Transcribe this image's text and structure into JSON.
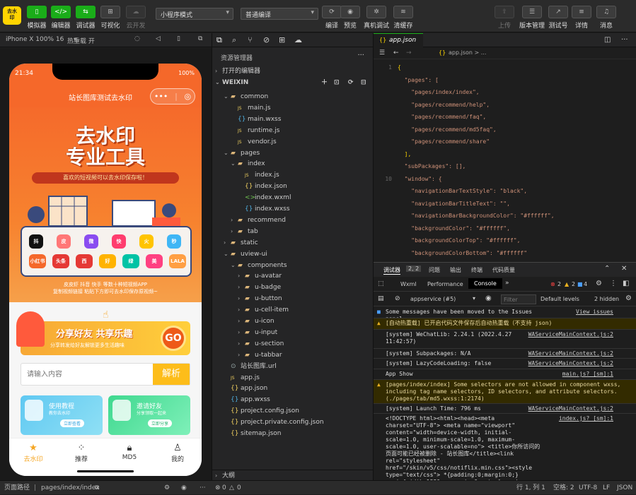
{
  "toolbar": {
    "buttons": [
      {
        "label": "模拟器",
        "icon": "phone-icon"
      },
      {
        "label": "编辑器",
        "icon": "code-icon"
      },
      {
        "label": "调试器",
        "icon": "debug-icon"
      },
      {
        "label": "可视化",
        "icon": "grid-icon"
      },
      {
        "label": "云开发",
        "icon": "cloud-icon"
      }
    ],
    "mode_select": "小程序模式",
    "compile_select": "普通编译",
    "mid_buttons": [
      "编译",
      "预览",
      "真机调试",
      "清缓存"
    ],
    "right_buttons": [
      "上传",
      "版本管理",
      "测试号",
      "详情",
      "消息"
    ]
  },
  "simulator": {
    "device": "iPhone X 100% 16",
    "hot_reload": "热重载 开",
    "status_time": "21:34",
    "battery": "100%",
    "nav_title": "站长图库测试去水印",
    "banner_title_1": "去水印",
    "banner_title_2": "专业工具",
    "ribbon": "喜欢的短视频可以去水印保存啦！",
    "banner_sub_1": "皮皮虾 抖音 快手 等数十种短视频APP",
    "banner_sub_2": "复制视频链接 粘贴下方即可去水印保存原视频~",
    "apps": [
      "抖",
      "皮",
      "微",
      "快",
      "火",
      "秒",
      "小红书",
      "头条",
      "西",
      "好",
      "绿",
      "美",
      "LALA"
    ],
    "share_title": "分享好友 共享乐趣",
    "share_sub": "分享转发给好友解锁更多生活趣味",
    "go": "GO",
    "search_placeholder": "请输入内容",
    "parse_button": "解析",
    "card1_title": "使用教程",
    "card1_sub": "教你去水印",
    "card1_btn": "立即查看",
    "card2_title": "邀请好友",
    "card2_sub": "分享领取一起来",
    "card2_btn": "立即分享",
    "tabs": [
      {
        "label": "去水印",
        "icon": "star-icon"
      },
      {
        "label": "推荐",
        "icon": "grid-icon"
      },
      {
        "label": "MD5",
        "icon": "lock-icon"
      },
      {
        "label": "我的",
        "icon": "user-icon"
      }
    ]
  },
  "explorer": {
    "title": "资源管理器",
    "open_editors": "打开的编辑器",
    "root": "WEIXIN",
    "outline": "大纲",
    "tree": [
      {
        "name": "common",
        "depth": 1,
        "type": "folder",
        "open": true
      },
      {
        "name": "main.js",
        "depth": 2,
        "type": "js"
      },
      {
        "name": "main.wxss",
        "depth": 2,
        "type": "wxss"
      },
      {
        "name": "runtime.js",
        "depth": 2,
        "type": "js"
      },
      {
        "name": "vendor.js",
        "depth": 2,
        "type": "js"
      },
      {
        "name": "pages",
        "depth": 1,
        "type": "folder",
        "open": true
      },
      {
        "name": "index",
        "depth": 2,
        "type": "folder",
        "open": true
      },
      {
        "name": "index.js",
        "depth": 3,
        "type": "js"
      },
      {
        "name": "index.json",
        "depth": 3,
        "type": "json"
      },
      {
        "name": "index.wxml",
        "depth": 3,
        "type": "wxml"
      },
      {
        "name": "index.wxss",
        "depth": 3,
        "type": "wxss"
      },
      {
        "name": "recommend",
        "depth": 2,
        "type": "folder",
        "open": false
      },
      {
        "name": "tab",
        "depth": 2,
        "type": "folder",
        "open": false
      },
      {
        "name": "static",
        "depth": 1,
        "type": "folder",
        "open": false
      },
      {
        "name": "uview-ui",
        "depth": 1,
        "type": "folder",
        "open": true
      },
      {
        "name": "components",
        "depth": 2,
        "type": "folder",
        "open": true
      },
      {
        "name": "u-avatar",
        "depth": 3,
        "type": "folder",
        "open": false
      },
      {
        "name": "u-badge",
        "depth": 3,
        "type": "folder",
        "open": false
      },
      {
        "name": "u-button",
        "depth": 3,
        "type": "folder",
        "open": false
      },
      {
        "name": "u-cell-item",
        "depth": 3,
        "type": "folder",
        "open": false
      },
      {
        "name": "u-icon",
        "depth": 3,
        "type": "folder",
        "open": false
      },
      {
        "name": "u-input",
        "depth": 3,
        "type": "folder",
        "open": false
      },
      {
        "name": "u-section",
        "depth": 3,
        "type": "folder",
        "open": false
      },
      {
        "name": "u-tabbar",
        "depth": 3,
        "type": "folder",
        "open": false
      },
      {
        "name": "站长图库.url",
        "depth": 1,
        "type": "url"
      },
      {
        "name": "app.js",
        "depth": 1,
        "type": "js"
      },
      {
        "name": "app.json",
        "depth": 1,
        "type": "json"
      },
      {
        "name": "app.wxss",
        "depth": 1,
        "type": "wxss"
      },
      {
        "name": "project.config.json",
        "depth": 1,
        "type": "json"
      },
      {
        "name": "project.private.config.json",
        "depth": 1,
        "type": "json"
      },
      {
        "name": "sitemap.json",
        "depth": 1,
        "type": "json"
      }
    ]
  },
  "editor": {
    "tab": "app.json",
    "breadcrumb": "app.json > ...",
    "lines": [
      {
        "n": "1",
        "t": "{"
      },
      {
        "n": "",
        "t": "  \"pages\": ["
      },
      {
        "n": "",
        "t": "    \"pages/index/index\","
      },
      {
        "n": "",
        "t": "    \"pages/recommend/help\","
      },
      {
        "n": "",
        "t": "    \"pages/recommend/faq\","
      },
      {
        "n": "",
        "t": "    \"pages/recommend/md5faq\","
      },
      {
        "n": "",
        "t": "    \"pages/recommend/share\""
      },
      {
        "n": "",
        "t": "  ],"
      },
      {
        "n": "",
        "t": "  \"subPackages\": [],"
      },
      {
        "n": "10",
        "t": "  \"window\": {"
      },
      {
        "n": "",
        "t": "    \"navigationBarTextStyle\": \"black\","
      },
      {
        "n": "",
        "t": "    \"navigationBarTitleText\": \"\","
      },
      {
        "n": "",
        "t": "    \"navigationBarBackgroundColor\": \"#ffffff\","
      },
      {
        "n": "",
        "t": "    \"backgroundColor\": \"#ffffff\","
      },
      {
        "n": "",
        "t": "    \"backgroundColorTop\": \"#ffffff\","
      },
      {
        "n": "",
        "t": "    \"backgroundColorBottom\": \"#ffffff\""
      },
      {
        "n": "",
        "t": "  },"
      }
    ]
  },
  "debugger": {
    "tabs": [
      "调试器",
      "2, 2",
      "问题",
      "输出",
      "终端",
      "代码质量"
    ],
    "devtabs": [
      "Wxml",
      "Performance",
      "Console"
    ],
    "errors": "2",
    "warnings": "2",
    "info": "4",
    "context": "appservice (#5)",
    "filter_placeholder": "Filter",
    "levels": "Default levels",
    "hidden": "2 hidden",
    "logs": [
      {
        "text": "Some messages have been moved to the Issues panel.",
        "src": "View issues",
        "type": "info"
      },
      {
        "text": "[自动热重载] 已开启代码文件保存后自动热重载（不支持 json)",
        "src": "",
        "type": "warn"
      },
      {
        "text": "[system] WeChatLib: 2.24.1 (2022.4.27 11:42:57)",
        "src": "WAServiceMainContext.js:2",
        "type": "log"
      },
      {
        "text": "[system] Subpackages: N/A",
        "src": "WAServiceMainContext.js:2",
        "type": "log"
      },
      {
        "text": "[system] LazyCodeLoading: false",
        "src": "WAServiceMainContext.js:2",
        "type": "log"
      },
      {
        "text": "App Show",
        "src": "main.js? [sm]:1",
        "type": "log"
      },
      {
        "text": "[pages/index/index] Some selectors are not allowed in component wxss, including tag name selectors, ID selectors, and attribute selectors.(./pages/tab/md5.wxss:1:2174)",
        "src": "",
        "type": "warn"
      },
      {
        "text": "[system] Launch Time: 796 ms",
        "src": "WAServiceMainContext.js:2",
        "type": "log"
      },
      {
        "text": "<!DOCTYPE html><html><head><meta charset=\"UTF-8\"> <meta name=\"viewport\" content=\"width=device-width, initial-scale=1.0, minimum-scale=1.0, maximum-scale=1.0, user-scalable=no\"> <title>你所访问的页面可能已经被删除 - 站长图库</title><link rel=\"stylesheet\" href=\"/skin/v5/css/notiflix.min.css\"><style type=\"text/css\">  *{padding:0;margin:0;}  .main{width:1380px;margin:0 auto;}  .main h2,.main h4,.main p{text-align:center;font-weight:normal;position:relative;z-index:2}  .header{height:60px;background",
        "src": "index.js? [sm]:1",
        "type": "log"
      }
    ]
  },
  "statusbar": {
    "path_label": "页面路径",
    "path": "pages/index/index",
    "errors_count": "0",
    "warnings_count": "0",
    "position": "行 1, 列 1",
    "spaces": "空格: 2",
    "encoding": "UTF-8",
    "eol": "LF",
    "lang": "JSON"
  },
  "colors": {
    "accent": "#1aad19",
    "banner": "#f5682a",
    "tab_active": "#f5a623"
  }
}
